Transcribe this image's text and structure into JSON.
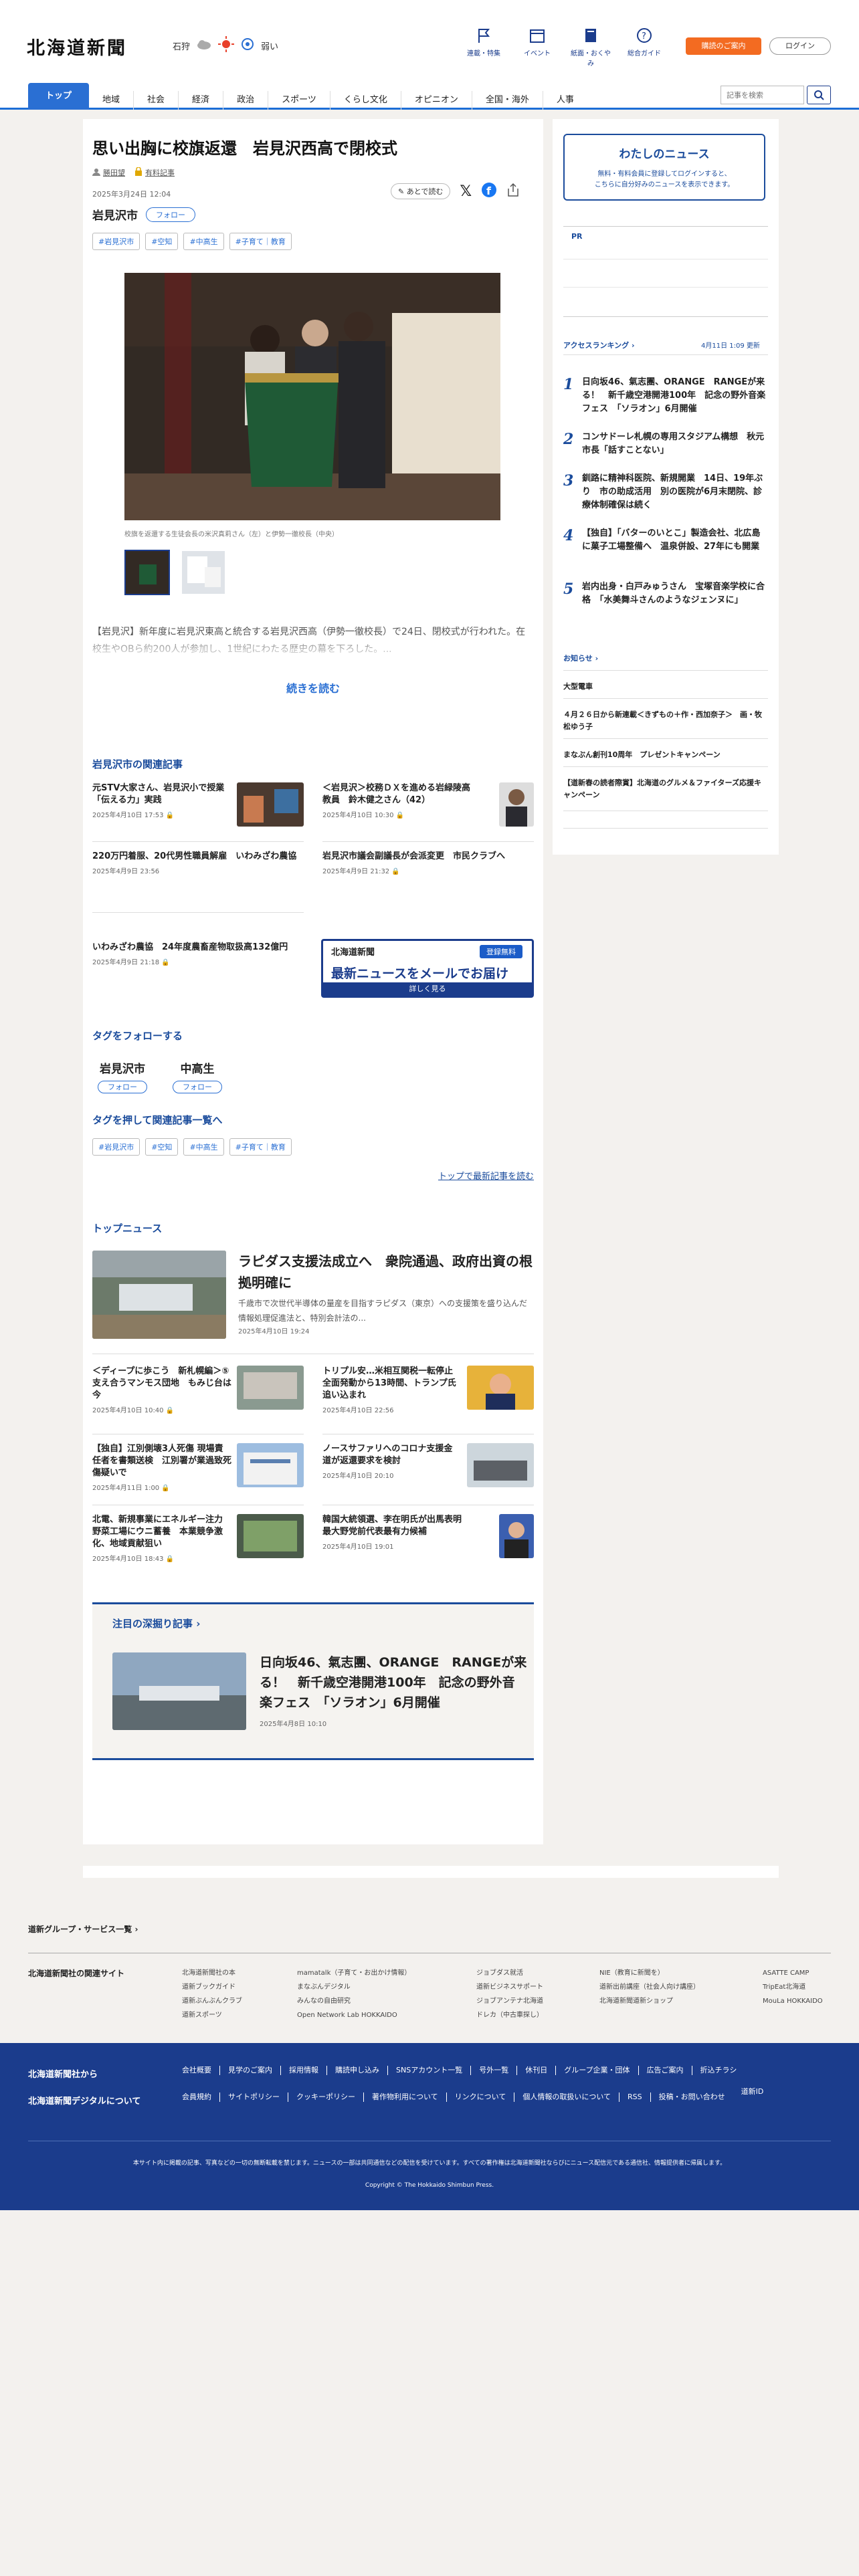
{
  "header": {
    "logo": "北海道新聞",
    "weather_city": "石狩",
    "uv_label": "弱い",
    "icons": [
      {
        "name": "flag-icon",
        "label": "連載・特集"
      },
      {
        "name": "calendar-icon",
        "label": "イベント"
      },
      {
        "name": "book-icon",
        "label": "紙面・おくやみ"
      },
      {
        "name": "help-icon",
        "label": "総合ガイド"
      }
    ],
    "register_label": "購読のご案内",
    "login_label": "ログイン"
  },
  "nav": {
    "items": [
      "トップ",
      "地域",
      "社会",
      "経済",
      "政治",
      "スポーツ",
      "くらし文化",
      "オピニオン",
      "全国・海外",
      "人事"
    ],
    "search_placeholder": "記事を検索"
  },
  "article": {
    "title": "思い出胸に校旗返還　岩見沢西高で閉校式",
    "author": "勝田望",
    "paid_label": "有料記事",
    "date": "2025年3月24日 12:04",
    "later_label": "あとで読む",
    "location": "岩見沢市",
    "follow_label": "フォロー",
    "tags": [
      "#岩見沢市",
      "#空知",
      "#中高生",
      "#子育て｜教育"
    ],
    "photo_caption": "校旗を返還する生徒会長の米沢真莉さん（左）と伊勢一徹校長（中央）",
    "lead": "【岩見沢】新年度に岩見沢東高と統合する岩見沢西高（伊勢一徹校長）で24日、閉校式が行われた。在校生やOBら約200人が参加し、1世紀にわたる歴史の幕を下ろした。...",
    "more_label": "続きを読む"
  },
  "related": {
    "heading": "岩見沢市の関連記事",
    "items": [
      {
        "title": "元STV大家さん、岩見沢小で授業　「伝える力」実践",
        "date": "2025年4月10日 17:53"
      },
      {
        "title": "＜岩見沢＞校務ＤＸを進める岩緑陵高教員　鈴木健之さん（42）",
        "date": "2025年4月10日 10:30"
      },
      {
        "title": "220万円着服、20代男性職員解雇　いわみざわ農協",
        "date": "2025年4月9日 23:56"
      },
      {
        "title": "岩見沢市議会副議長が会派変更　市民クラブへ",
        "date": "2025年4月9日 21:32"
      },
      {
        "title": "いわみざわ農協　24年度農畜産物取扱高132億円",
        "date": "2025年4月9日 21:18"
      }
    ],
    "mail_logo": "北海道新聞",
    "mail_free": "登録無料",
    "mail_title": "最新ニュースをメールでお届け",
    "mail_more": "詳しく見る"
  },
  "follow_tags": {
    "heading": "タグをフォローする",
    "items": [
      {
        "name": "岩見沢市",
        "button": "フォロー"
      },
      {
        "name": "中高生",
        "button": "フォロー"
      }
    ]
  },
  "tag_list": {
    "heading": "タグを押して関連記事一覧へ",
    "tags": [
      "#岩見沢市",
      "#空知",
      "#中高生",
      "#子育て｜教育"
    ],
    "top_link": "トップで最新記事を読む"
  },
  "top_news": {
    "heading": "トップニュース",
    "lead_title": "ラピダス支援法成立へ　衆院通過、政府出資の根拠明確に",
    "lead_summary": "千歳市で次世代半導体の量産を目指すラピダス（東京）への支援策を盛り込んだ情報処理促進法と、特別会計法の...",
    "lead_date": "2025年4月10日 19:24",
    "items": [
      {
        "title": "＜ディープに歩こう　新札幌編＞⑤支え合うマンモス団地　もみじ台は今",
        "date": "2025年4月10日 10:40"
      },
      {
        "title": "トリプル安…米相互関税一転停止　全面発動から13時間、トランプ氏追い込まれ",
        "date": "2025年4月10日 22:56"
      },
      {
        "title": "【独自】江別側壊3人死傷 現場責任者を書類送検　江別署が業過致死傷疑いで",
        "date": "2025年4月11日 1:00"
      },
      {
        "title": "ノースサファリへのコロナ支援金　道が返還要求を検討",
        "date": "2025年4月10日 20:10"
      },
      {
        "title": "北電、新規事業にエネルギー注力　野菜工場にウニ蓄養　本業競争激化、地域貢献狙い",
        "date": "2025年4月10日 18:43"
      },
      {
        "title": "韓国大統領選、李在明氏が出馬表明　最大野党前代表最有力候補",
        "date": "2025年4月10日 19:01"
      }
    ]
  },
  "deep": {
    "heading": "注目の深掘り記事",
    "title": "日向坂46、氣志團、ORANGE　RANGEが来る！　新千歳空港開港100年　記念の野外音楽フェス　「ソラオン」6月開催",
    "date": "2025年4月8日 10:10"
  },
  "sidebar": {
    "mynews_title": "わたしのニュース",
    "mynews_text_1": "無料・有料会員に登録してログインすると、",
    "mynews_text_2": "こちらに自分好みのニュースを表示できます。",
    "pr_label": "PR",
    "ranking_heading": "アクセスランキング",
    "ranking_updated": "4月11日 1:09 更新",
    "ranking": [
      {
        "n": "1",
        "title": "日向坂46、氣志團、ORANGE　RANGEが来る！　新千歳空港開港100年　記念の野外音楽フェス　「ソラオン」6月開催"
      },
      {
        "n": "2",
        "title": "コンサドーレ札幌の専用スタジアム構想　秋元市長「話すことない」"
      },
      {
        "n": "3",
        "title": "釧路に精神科医院、新規開業　14日、19年ぶり　市の助成活用　別の医院が6月末閉院、診療体制確保は続く"
      },
      {
        "n": "4",
        "title": "【独自】「バターのいとこ」製造会社、北広島に菓子工場整備へ　温泉併設、27年にも開業"
      },
      {
        "n": "5",
        "title": "岩内出身・白戸みゅうさん　宝塚音楽学校に合格　「水美舞斗さんのようなジェンヌに」"
      }
    ],
    "notice_heading": "お知らせ",
    "notices": [
      "大型電車",
      "４月２６日から新連載＜きずもの＋作・西加奈子＞　画・牧松ゆう子",
      "まなぶん創刊10周年　プレゼントキャンペーン",
      "【道新春の読者際賞】北海道のグルメ＆ファイターズ応援キャンペーン"
    ]
  },
  "footer": {
    "group_link": "道新グループ・サービス一覧",
    "related_label": "北海道新聞社の関連サイト",
    "related_cols": [
      [
        "北海道新聞社の本",
        "道新ブックガイド",
        "道新ぶんぶんクラブ",
        "道新スポーツ"
      ],
      [
        "mamatalk（子育て・お出かけ情報）",
        "まなぶんデジタル",
        "みんなの自由研究",
        "Open Network Lab HOKKAIDO"
      ],
      [
        "ジョブダス就活",
        "道新ビジネスサポート",
        "ジョブアンテナ北海道",
        "ドレカ（中古車探し）"
      ],
      [
        "NIE（教育に新聞を）",
        "道新出前講座（社会人向け講座）",
        "北海道新聞道新ショップ"
      ],
      [
        "ASATTE CAMP",
        "TripEat北海道",
        "MouLa HOKKAIDO"
      ]
    ],
    "company_label": "北海道新聞社から",
    "company_links": [
      "会社概要",
      "見学のご案内",
      "採用情報",
      "購読申し込み",
      "SNSアカウント一覧",
      "号外一覧",
      "休刊日",
      "グループ企業・団体",
      "広告ご案内",
      "折込チラシ"
    ],
    "digital_label": "北海道新聞デジタルについて",
    "digital_links": [
      "会員規約",
      "サイトポリシー",
      "クッキーポリシー",
      "著作物利用について",
      "リンクについて",
      "個人情報の取扱いについて",
      "RSS",
      "投稿・お問い合わせ",
      "道新ID"
    ],
    "note": "本サイト内に掲載の記事、写真などの一切の無断転載を禁じます。ニュースの一部は共同通信などの配信を受けています。すべての著作権は北海道新聞社ならびにニュース配信元である通信社、情報提供者に帰属します。",
    "copyright": "Copyright © The Hokkaido Shimbun Press."
  },
  "colors": {
    "brand_blue": "#1b3c8c",
    "accent_blue": "#2a6fd3",
    "orange": "#f36b21"
  }
}
